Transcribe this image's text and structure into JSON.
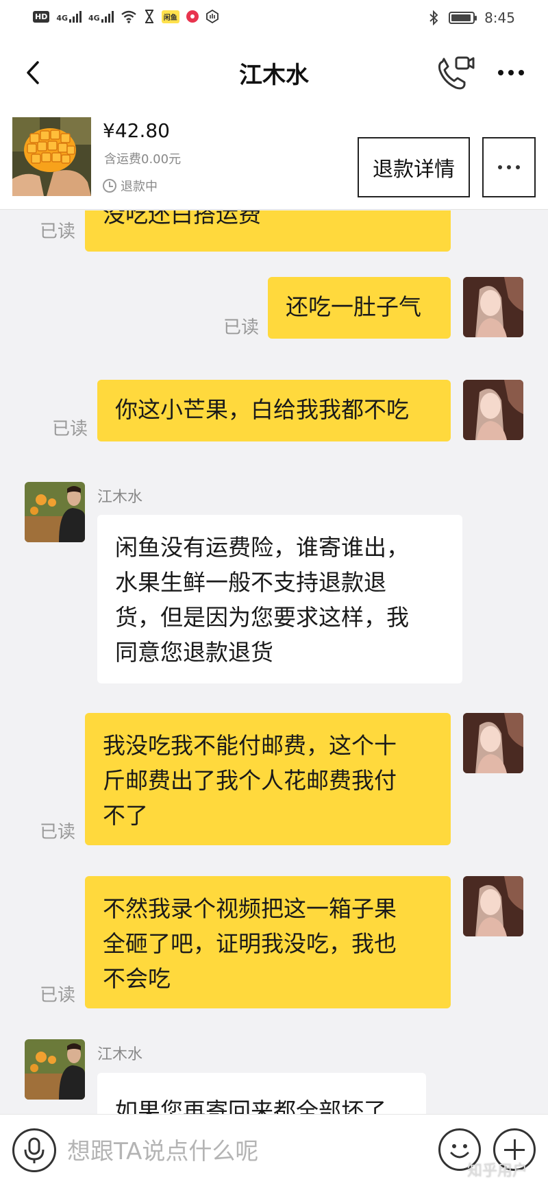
{
  "status_bar": {
    "hd": "HD",
    "signal1": "4G",
    "signal2": "4G",
    "app_badge": "闲鱼",
    "time": "8:45"
  },
  "header": {
    "title": "江木水"
  },
  "product": {
    "price": "¥42.80",
    "shipping": "含运费0.00元",
    "status": "退款中",
    "refund_button": "退款详情"
  },
  "messages": [
    {
      "from": "me",
      "text": "没吃还白搭运费",
      "read": "已读"
    },
    {
      "from": "me",
      "text": "还吃一肚子气",
      "read": "已读"
    },
    {
      "from": "me",
      "text": "你这小芒果，白给我我都不吃",
      "read": "已读"
    },
    {
      "from": "other",
      "sender": "江木水",
      "lines": [
        "闲鱼没有运费险，谁寄谁出，",
        "水果生鲜一般不支持退款退",
        "货，但是因为您要求这样，我",
        "同意您退款退货"
      ]
    },
    {
      "from": "me",
      "read": "已读",
      "lines": [
        "我没吃我不能付邮费，这个十",
        "斤邮费出了我个人花邮费我付",
        "不了"
      ]
    },
    {
      "from": "me",
      "read": "已读",
      "lines": [
        "不然我录个视频把这一箱子果",
        "全砸了吧，证明我没吃，我也",
        "不会吃"
      ]
    },
    {
      "from": "other",
      "sender": "江木水",
      "lines": [
        "如果您再寄回来都全部坏了"
      ]
    }
  ],
  "input": {
    "placeholder": "想跟TA说点什么呢"
  },
  "watermark": "知乎用户",
  "colors": {
    "my_bubble": "#ffd93d",
    "other_bubble": "#ffffff",
    "chat_background": "#f2f2f4"
  }
}
